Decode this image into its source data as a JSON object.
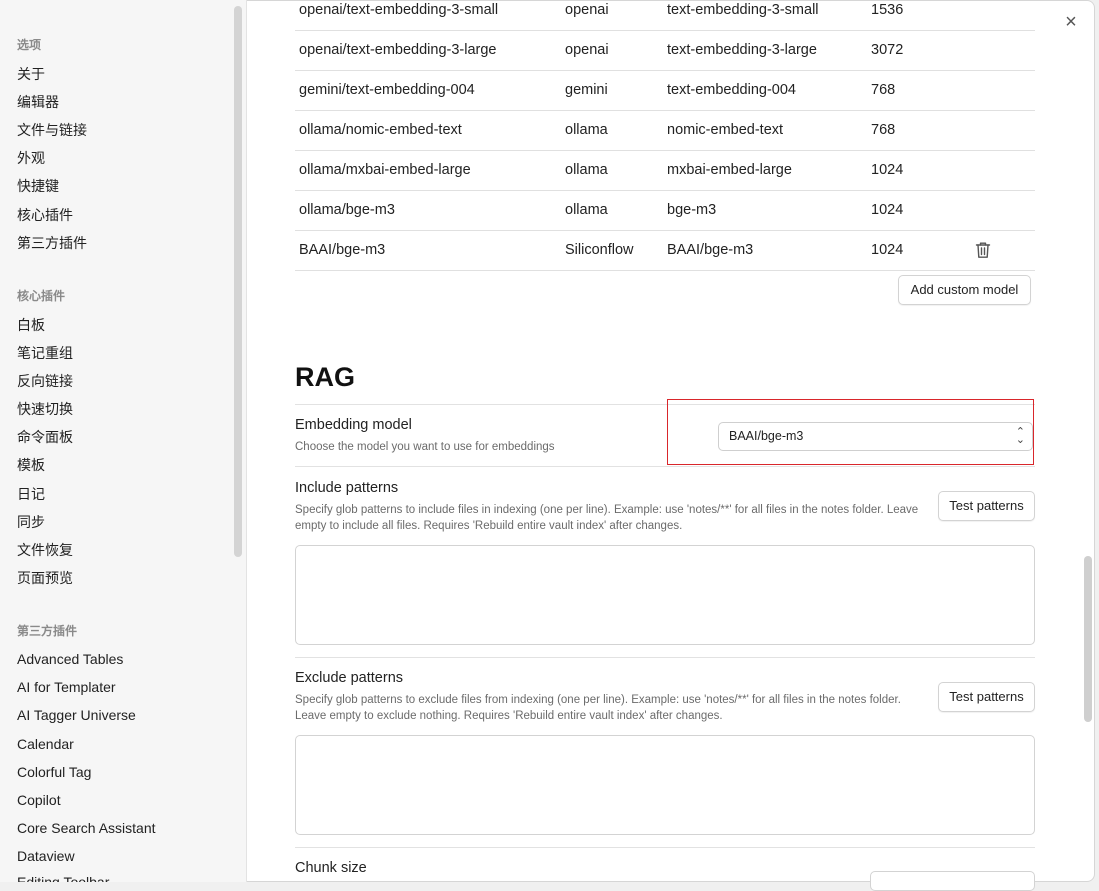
{
  "sidebar": {
    "sections": [
      {
        "title": "选项",
        "items": [
          "关于",
          "编辑器",
          "文件与链接",
          "外观",
          "快捷键",
          "核心插件",
          "第三方插件"
        ]
      },
      {
        "title": "核心插件",
        "items": [
          "白板",
          "笔记重组",
          "反向链接",
          "快速切换",
          "命令面板",
          "模板",
          "日记",
          "同步",
          "文件恢复",
          "页面预览"
        ]
      },
      {
        "title": "第三方插件",
        "items": [
          "Advanced Tables",
          "AI for Templater",
          "AI Tagger Universe",
          "Calendar",
          "Colorful Tag",
          "Copilot",
          "Core Search Assistant",
          "Dataview",
          "Editing Toolbar"
        ]
      }
    ]
  },
  "close_icon": "×",
  "models_table": {
    "rows": [
      {
        "name": "openai/text-embedding-3-small",
        "provider": "openai",
        "model": "text-embedding-3-small",
        "dim": "1536",
        "deletable": false
      },
      {
        "name": "openai/text-embedding-3-large",
        "provider": "openai",
        "model": "text-embedding-3-large",
        "dim": "3072",
        "deletable": false
      },
      {
        "name": "gemini/text-embedding-004",
        "provider": "gemini",
        "model": "text-embedding-004",
        "dim": "768",
        "deletable": false
      },
      {
        "name": "ollama/nomic-embed-text",
        "provider": "ollama",
        "model": "nomic-embed-text",
        "dim": "768",
        "deletable": false
      },
      {
        "name": "ollama/mxbai-embed-large",
        "provider": "ollama",
        "model": "mxbai-embed-large",
        "dim": "1024",
        "deletable": false
      },
      {
        "name": "ollama/bge-m3",
        "provider": "ollama",
        "model": "bge-m3",
        "dim": "1024",
        "deletable": false
      },
      {
        "name": "BAAI/bge-m3",
        "provider": "Siliconflow",
        "model": "BAAI/bge-m3",
        "dim": "1024",
        "deletable": true
      }
    ],
    "add_button": "Add custom model",
    "delete_icon": "trash-icon"
  },
  "rag": {
    "heading": "RAG",
    "embedding_model": {
      "name": "Embedding model",
      "desc": "Choose the model you want to use for embeddings",
      "selected": "BAAI/bge-m3"
    },
    "include_patterns": {
      "name": "Include patterns",
      "desc": "Specify glob patterns to include files in indexing (one per line). Example: use 'notes/**' for all files in the notes folder. Leave empty to include all files. Requires 'Rebuild entire vault index' after changes.",
      "button": "Test patterns",
      "value": ""
    },
    "exclude_patterns": {
      "name": "Exclude patterns",
      "desc": "Specify glob patterns to exclude files from indexing (one per line). Example: use 'notes/**' for all files in the notes folder. Leave empty to exclude nothing. Requires 'Rebuild entire vault index' after changes.",
      "button": "Test patterns",
      "value": ""
    },
    "chunk_size": {
      "name": "Chunk size"
    }
  },
  "colors": {
    "highlight_border": "#d9262b",
    "sidebar_bg": "#f6f6f6"
  }
}
